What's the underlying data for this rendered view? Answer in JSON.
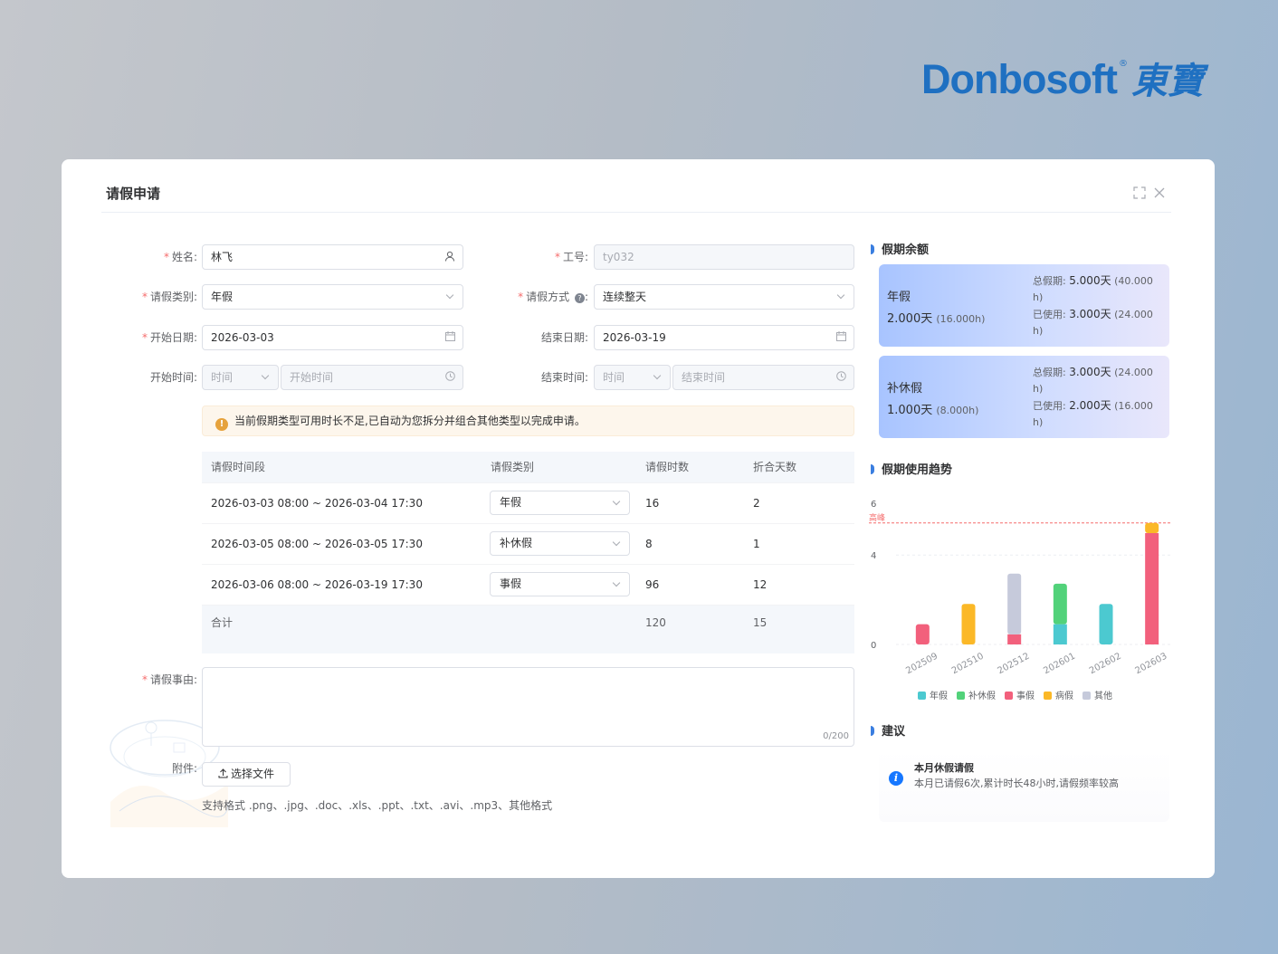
{
  "brand": {
    "name": "Donbosoft",
    "reg": "®",
    "cn": "東寶",
    "color": "#1f70c1"
  },
  "dialog": {
    "title": "请假申请",
    "fullscreen_icon": "fullscreen-icon",
    "close_icon": "close-icon"
  },
  "form": {
    "name_label": "姓名:",
    "name_value": "林飞",
    "empno_label": "工号:",
    "empno_value": "ty032",
    "leave_type_label": "请假类别:",
    "leave_type_value": "年假",
    "leave_mode_label": "请假方式",
    "leave_mode_value": "连续整天",
    "start_date_label": "开始日期:",
    "start_date_value": "2026-03-03",
    "end_date_label": "结束日期:",
    "end_date_value": "2026-03-19",
    "start_time_label": "开始时间:",
    "end_time_label": "结束时间:",
    "time_select_placeholder": "时间",
    "start_time_placeholder": "开始时间",
    "end_time_placeholder": "结束时间",
    "alert": "当前假期类型可用时长不足,已自动为您拆分并组合其他类型以完成申请。",
    "reason_label": "请假事由:",
    "reason_counter": "0/200",
    "attachment_label": "附件:",
    "upload_label": "选择文件",
    "format_hint": "支持格式 .png、.jpg、.doc、.xls、.ppt、.txt、.avi、.mp3、其他格式"
  },
  "table": {
    "headers": [
      "请假时间段",
      "请假类别",
      "请假时数",
      "折合天数"
    ],
    "rows": [
      {
        "period": "2026-03-03 08:00 ~ 2026-03-04 17:30",
        "type": "年假",
        "hours": "16",
        "days": "2"
      },
      {
        "period": "2026-03-05 08:00 ~ 2026-03-05 17:30",
        "type": "补休假",
        "hours": "8",
        "days": "1"
      },
      {
        "period": "2026-03-06 08:00 ~ 2026-03-19 17:30",
        "type": "事假",
        "hours": "96",
        "days": "12"
      }
    ],
    "total": {
      "label": "合计",
      "hours": "120",
      "days": "15"
    }
  },
  "balance": {
    "title": "假期余额",
    "total_label": "总假期:",
    "used_label": "已使用:",
    "cards": [
      {
        "name": "年假",
        "remain": "2.000天",
        "remain_h": "(16.000h)",
        "total": "5.000天",
        "total_h": "(40.000",
        "total_h2": "h)",
        "used": "3.000天",
        "used_h": "(24.000",
        "used_h2": "h)"
      },
      {
        "name": "补休假",
        "remain": "1.000天",
        "remain_h": "(8.000h)",
        "total": "3.000天",
        "total_h": "(24.000",
        "total_h2": "h)",
        "used": "2.000天",
        "used_h": "(16.000",
        "used_h2": "h)"
      }
    ]
  },
  "trend": {
    "title": "假期使用趋势",
    "peak_label": "高峰"
  },
  "chart_data": {
    "type": "bar",
    "stacked": true,
    "categories": [
      "202509",
      "202510",
      "202512",
      "202601",
      "202602",
      "202603"
    ],
    "series": [
      {
        "name": "年假",
        "color": "#4cc9d0",
        "values": [
          0,
          0,
          0,
          1,
          2,
          0
        ]
      },
      {
        "name": "补休假",
        "color": "#52d27a",
        "values": [
          0,
          0,
          0,
          2,
          0,
          0
        ]
      },
      {
        "name": "事假",
        "color": "#f2607c",
        "values": [
          1,
          0,
          0.5,
          0,
          0,
          5.5
        ]
      },
      {
        "name": "病假",
        "color": "#fbb827",
        "values": [
          0,
          2,
          0,
          0,
          0,
          0.5
        ]
      },
      {
        "name": "其他",
        "color": "#c6cadb",
        "values": [
          0,
          0,
          3,
          0,
          0,
          0
        ]
      }
    ],
    "yticks": [
      "0",
      "4",
      "6"
    ],
    "ylim": [
      0,
      6
    ],
    "peak": 6,
    "legend_position": "bottom"
  },
  "suggestion": {
    "title": "建议",
    "item_title": "本月休假请假",
    "item_text": "本月已请假6次,累计时长48小时,请假频率较高"
  }
}
